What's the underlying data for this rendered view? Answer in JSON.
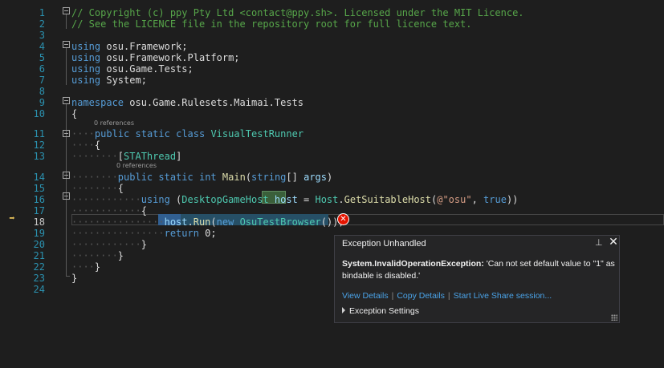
{
  "editor": {
    "lines": [
      {
        "num": "1",
        "html": "<span class='c'>// Copyright (c) ppy Pty Ltd &lt;contact@ppy.sh&gt;. Licensed under the MIT Licence.</span>"
      },
      {
        "num": "2",
        "html": "<span class='c'>// See the LICENCE file in the repository root for full licence text.</span>"
      },
      {
        "num": "3",
        "html": ""
      },
      {
        "num": "4",
        "html": "<span class='k'>using</span> osu.Framework;"
      },
      {
        "num": "5",
        "html": "<span class='k'>using</span> osu.Framework.Platform;"
      },
      {
        "num": "6",
        "html": "<span class='k'>using</span> osu.Game.Tests;"
      },
      {
        "num": "7",
        "html": "<span class='k'>using</span> System;"
      },
      {
        "num": "8",
        "html": ""
      },
      {
        "num": "9",
        "html": "<span class='k'>namespace</span> osu.Game.Rulesets.Maimai.Tests"
      },
      {
        "num": "10",
        "html": "{"
      },
      {
        "num": "11",
        "html": "<span class='dots'>····</span><span class='k'>public</span> <span class='k'>static</span> <span class='k'>class</span> <span class='t'>VisualTestRunner</span>"
      },
      {
        "num": "12",
        "html": "<span class='dots'>····</span>{"
      },
      {
        "num": "13",
        "html": "<span class='dots'>········</span>[<span class='a'>STAThread</span>]"
      },
      {
        "num": "14",
        "html": "<span class='dots'>········</span><span class='k'>public</span> <span class='k'>static</span> <span class='k'>int</span> <span class='m'>Main</span>(<span class='k'>string</span>[] <span class='p'>args</span>)"
      },
      {
        "num": "15",
        "html": "<span class='dots'>········</span>{"
      },
      {
        "num": "16",
        "html": "<span class='dots'>············</span><span class='k'>using</span> (<span class='t'>DesktopGameHost</span> <span class='p'>host</span> = <span class='t'>Host</span>.<span class='m'>GetSuitableHost</span>(<span class='s'>@\"osu\"</span>, <span class='k'>true</span>))"
      },
      {
        "num": "17",
        "html": "<span class='dots'>············</span>{"
      },
      {
        "num": "18",
        "html": "<span class='dots'>················</span><span class='p'>host</span>.<span class='m'>Run</span>(<span class='k'>new</span> <span class='t'>OsuTestBrowser</span>());"
      },
      {
        "num": "19",
        "html": "<span class='dots'>················</span><span class='k'>return</span> 0;"
      },
      {
        "num": "20",
        "html": "<span class='dots'>············</span>}"
      },
      {
        "num": "21",
        "html": "<span class='dots'>········</span>}"
      },
      {
        "num": "22",
        "html": "<span class='dots'>····</span>}"
      },
      {
        "num": "23",
        "html": "}"
      },
      {
        "num": "24",
        "html": ""
      }
    ],
    "codelens": [
      "0 references",
      "0 references"
    ],
    "current_line": "18"
  },
  "exception": {
    "title": "Exception Unhandled",
    "type": "System.InvalidOperationException:",
    "message": "'Can not set default value to \"1\" as bindable is disabled.'",
    "links": [
      "View Details",
      "Copy Details",
      "Start Live Share session..."
    ],
    "settings": "Exception Settings"
  },
  "colors": {
    "background": "#1e1e1e",
    "keyword": "#569cd6",
    "type": "#4ec9b0",
    "comment": "#57a64a",
    "line_number": "#2b91af",
    "error": "#e51400",
    "link": "#4aa3e8"
  }
}
